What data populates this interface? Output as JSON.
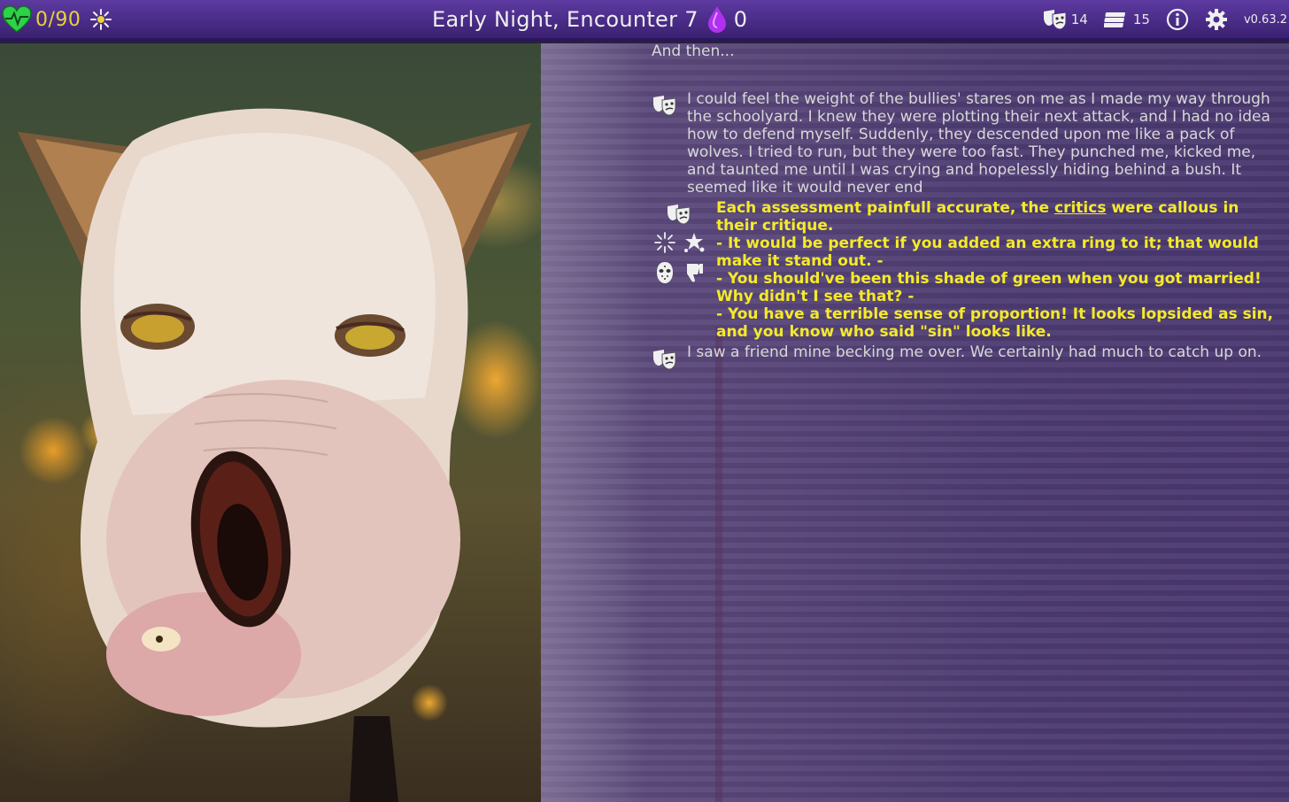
{
  "header": {
    "health": "0/90",
    "title": "Early Night, Encounter 7",
    "soul_count": "0",
    "masks_count": "14",
    "money_count": "15",
    "version": "v0.63.2"
  },
  "colors": {
    "health_green": "#2fd04a",
    "highlight_yellow": "#f4ea2a",
    "soul_purple": "#b030f0",
    "topbar_purple": "#4a2c88"
  },
  "icons": {
    "heart": "heart-icon",
    "burst": "burst-icon",
    "soul": "soul-drop-icon",
    "masks": "theater-masks-icon",
    "money": "money-stack-icon",
    "info": "info-icon",
    "settings": "gear-icon"
  },
  "log": {
    "intro": "And then...",
    "entry1": "I could feel the weight of the bullies' stares on me as I made my way through the schoolyard. I knew they were plotting their next attack, and I had no idea how to defend myself. Suddenly, they descended upon me like a pack of wolves.  I tried to run, but they were too fast. They punched me, kicked me, and taunted me until I was crying and hopelessly hiding behind a bush. It seemed like it would never end",
    "event_pre": "Each assessment painfull accurate, the ",
    "event_link": "critics",
    "event_post": " were callous in their critique.",
    "critique1": "- It would be perfect if you added an extra ring to it; that would make it stand out. -",
    "critique2": "- You should've been this shade of green when you got married! Why didn't I see that? -",
    "critique3": "- You have a terrible sense of proportion! It looks lopsided as sin, and you know who said \"sin\" looks like.",
    "entry2": "I saw a friend mine becking me over. We certainly had much to catch up on."
  }
}
